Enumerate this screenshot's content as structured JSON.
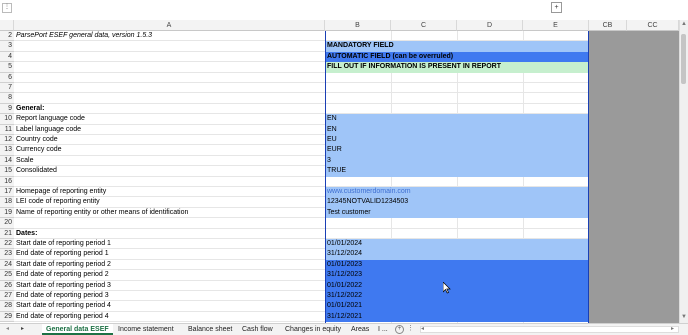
{
  "columns": [
    "A",
    "B",
    "C",
    "D",
    "E",
    "CB",
    "CC"
  ],
  "rows": [
    {
      "n": "2",
      "a": "ParsePort ESEF general data, version 1.5.3",
      "b": "",
      "a_style": "italic",
      "b_fill": ""
    },
    {
      "n": "3",
      "a": "",
      "b": "MANDATORY FIELD",
      "b_fill": "#9fc5f8",
      "b_bold": true
    },
    {
      "n": "4",
      "a": "",
      "b": "AUTOMATIC FIELD (can be overruled)",
      "b_fill": "#3f79f0",
      "b_bold": true
    },
    {
      "n": "5",
      "a": "",
      "b": "FILL OUT IF INFORMATION IS PRESENT IN REPORT",
      "b_fill": "#c6efce",
      "b_bold": true
    },
    {
      "n": "6",
      "a": "",
      "b": "",
      "b_fill": ""
    },
    {
      "n": "7",
      "a": "",
      "b": "",
      "b_fill": ""
    },
    {
      "n": "8",
      "a": "",
      "b": "",
      "b_fill": ""
    },
    {
      "n": "9",
      "a": "General:",
      "a_style": "bold",
      "b": "",
      "b_fill": ""
    },
    {
      "n": "10",
      "a": "Report language code",
      "b": "EN",
      "b_fill": "#9fc5f8"
    },
    {
      "n": "11",
      "a": "Label language code",
      "b": "EN",
      "b_fill": "#9fc5f8"
    },
    {
      "n": "12",
      "a": "Country code",
      "b": "EU",
      "b_fill": "#9fc5f8"
    },
    {
      "n": "13",
      "a": "Currency code",
      "b": "EUR",
      "b_fill": "#9fc5f8"
    },
    {
      "n": "14",
      "a": "Scale",
      "b": "3",
      "b_fill": "#9fc5f8"
    },
    {
      "n": "15",
      "a": "Consolidated",
      "b": "TRUE",
      "b_fill": "#9fc5f8"
    },
    {
      "n": "16",
      "a": "",
      "b": "",
      "b_fill": ""
    },
    {
      "n": "17",
      "a": "Homepage of reporting entity",
      "b": "www.customerdomain.com",
      "b_fill": "#9fc5f8",
      "b_color": "#3f6fd1"
    },
    {
      "n": "18",
      "a": "LEI code of reporting entity",
      "b": "12345NOTVALID1234503",
      "b_fill": "#9fc5f8"
    },
    {
      "n": "19",
      "a": "Name of reporting entity or other means of identification",
      "b": "Test customer",
      "b_fill": "#9fc5f8"
    },
    {
      "n": "20",
      "a": "",
      "b": "",
      "b_fill": ""
    },
    {
      "n": "21",
      "a": "Dates:",
      "a_style": "bold",
      "b": "",
      "b_fill": ""
    },
    {
      "n": "22",
      "a": "Start date of reporting period 1",
      "b": "01/01/2024",
      "b_fill": "#9fc5f8"
    },
    {
      "n": "23",
      "a": "End date of reporting period 1",
      "b": "31/12/2024",
      "b_fill": "#9fc5f8"
    },
    {
      "n": "24",
      "a": "Start date of reporting period 2",
      "b": "01/01/2023",
      "b_fill": "#3f79f0"
    },
    {
      "n": "25",
      "a": "End date of reporting period 2",
      "b": "31/12/2023",
      "b_fill": "#3f79f0"
    },
    {
      "n": "26",
      "a": "Start date of reporting period 3",
      "b": "01/01/2022",
      "b_fill": "#3f79f0"
    },
    {
      "n": "27",
      "a": "End date of reporting period 3",
      "b": "31/12/2022",
      "b_fill": "#3f79f0"
    },
    {
      "n": "28",
      "a": "Start date of reporting period 4",
      "b": "01/01/2021",
      "b_fill": "#3f79f0"
    },
    {
      "n": "29",
      "a": "End date of reporting period 4",
      "b": "31/12/2021",
      "b_fill": "#3f79f0"
    }
  ],
  "sheet_tabs": [
    "General data ESEF",
    "Income statement",
    "Balance sheet",
    "Cash flow",
    "Changes in equity",
    "Areas",
    "I ..."
  ],
  "colors": {
    "mandatory": "#9fc5f8",
    "automatic": "#3f79f0",
    "optional": "#c6efce",
    "selection_border": "#1a3fb5",
    "grey_area": "#9a9a9a"
  }
}
